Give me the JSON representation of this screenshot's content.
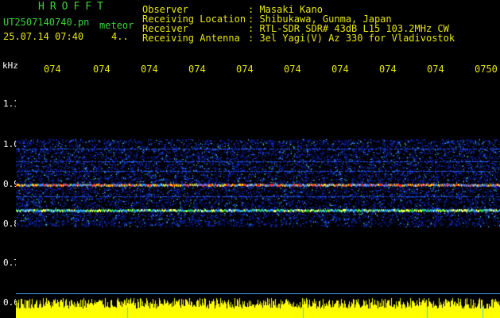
{
  "header": {
    "left_title": "HROFFT",
    "filename": "UT2507140740.pn",
    "meteor_label": "meteor",
    "datetime": "25.07.14 07:40",
    "count": "4.."
  },
  "info": [
    {
      "label": "Observer",
      "value": ": Masaki Kano"
    },
    {
      "label": "Receiving Location",
      "value": ": Shibukawa, Gunma, Japan"
    },
    {
      "label": "Receiver",
      "value": ": RTL-SDR SDR# 43dB L15 103.2MHz CW"
    },
    {
      "label": "Receiving Antenna",
      "value": ": 3el Yagi(V) Az 330 for Vladivostok"
    }
  ],
  "y_axis": {
    "unit": "kHz",
    "ticks": [
      "1.1",
      "1.0",
      "0.9",
      "0.8",
      "0.7",
      "0.6"
    ]
  },
  "x_axis": {
    "ticks": [
      "074",
      "074",
      "074",
      "074",
      "074",
      "074",
      "074",
      "074",
      "074",
      "0750"
    ]
  },
  "colors": {
    "label_green": "#3cd23c",
    "tick_yellow": "#e6e600",
    "band_blue": "#1a3cff",
    "band_red": "#ff2020",
    "noise_yellow": "#ffff00"
  }
}
